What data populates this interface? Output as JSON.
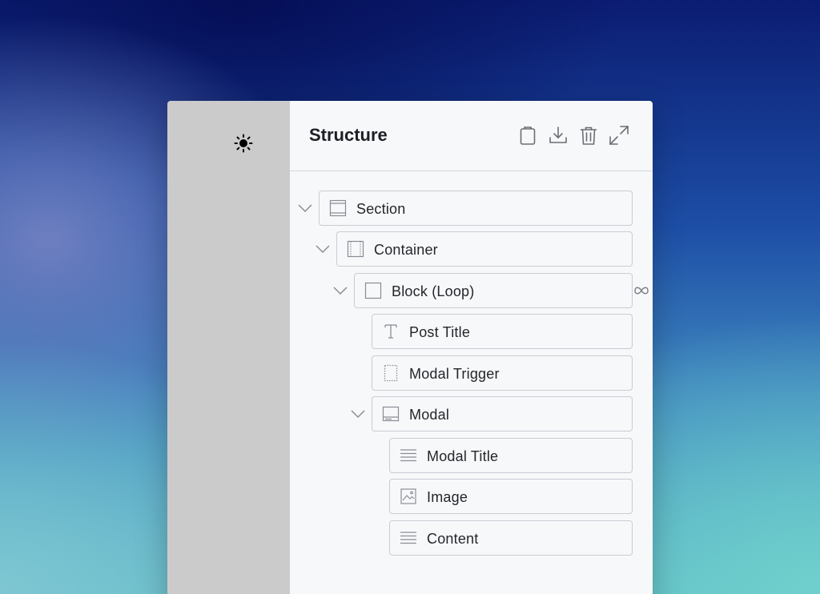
{
  "sidebar": {
    "theme_icon": "sun-icon"
  },
  "panel": {
    "title": "Structure",
    "actions": [
      {
        "name": "clipboard-icon"
      },
      {
        "name": "download-icon"
      },
      {
        "name": "trash-icon"
      },
      {
        "name": "expand-icon"
      }
    ]
  },
  "tree": [
    {
      "label": "Section",
      "icon": "section-icon",
      "level": 0,
      "collapsible": true
    },
    {
      "label": "Container",
      "icon": "container-icon",
      "level": 1,
      "collapsible": true
    },
    {
      "label": "Block (Loop)",
      "icon": "block-icon",
      "level": 2,
      "collapsible": true,
      "badge": "loop-icon"
    },
    {
      "label": "Post Title",
      "icon": "heading-icon",
      "level": 3,
      "collapsible": false
    },
    {
      "label": "Modal Trigger",
      "icon": "trigger-icon",
      "level": 3,
      "collapsible": false
    },
    {
      "label": "Modal",
      "icon": "modal-icon",
      "level": 3,
      "collapsible": true
    },
    {
      "label": "Modal Title",
      "icon": "text-lines-icon",
      "level": 4,
      "collapsible": false
    },
    {
      "label": "Image",
      "icon": "image-icon",
      "level": 4,
      "collapsible": false
    },
    {
      "label": "Content",
      "icon": "text-lines-icon",
      "level": 4,
      "collapsible": false
    }
  ]
}
